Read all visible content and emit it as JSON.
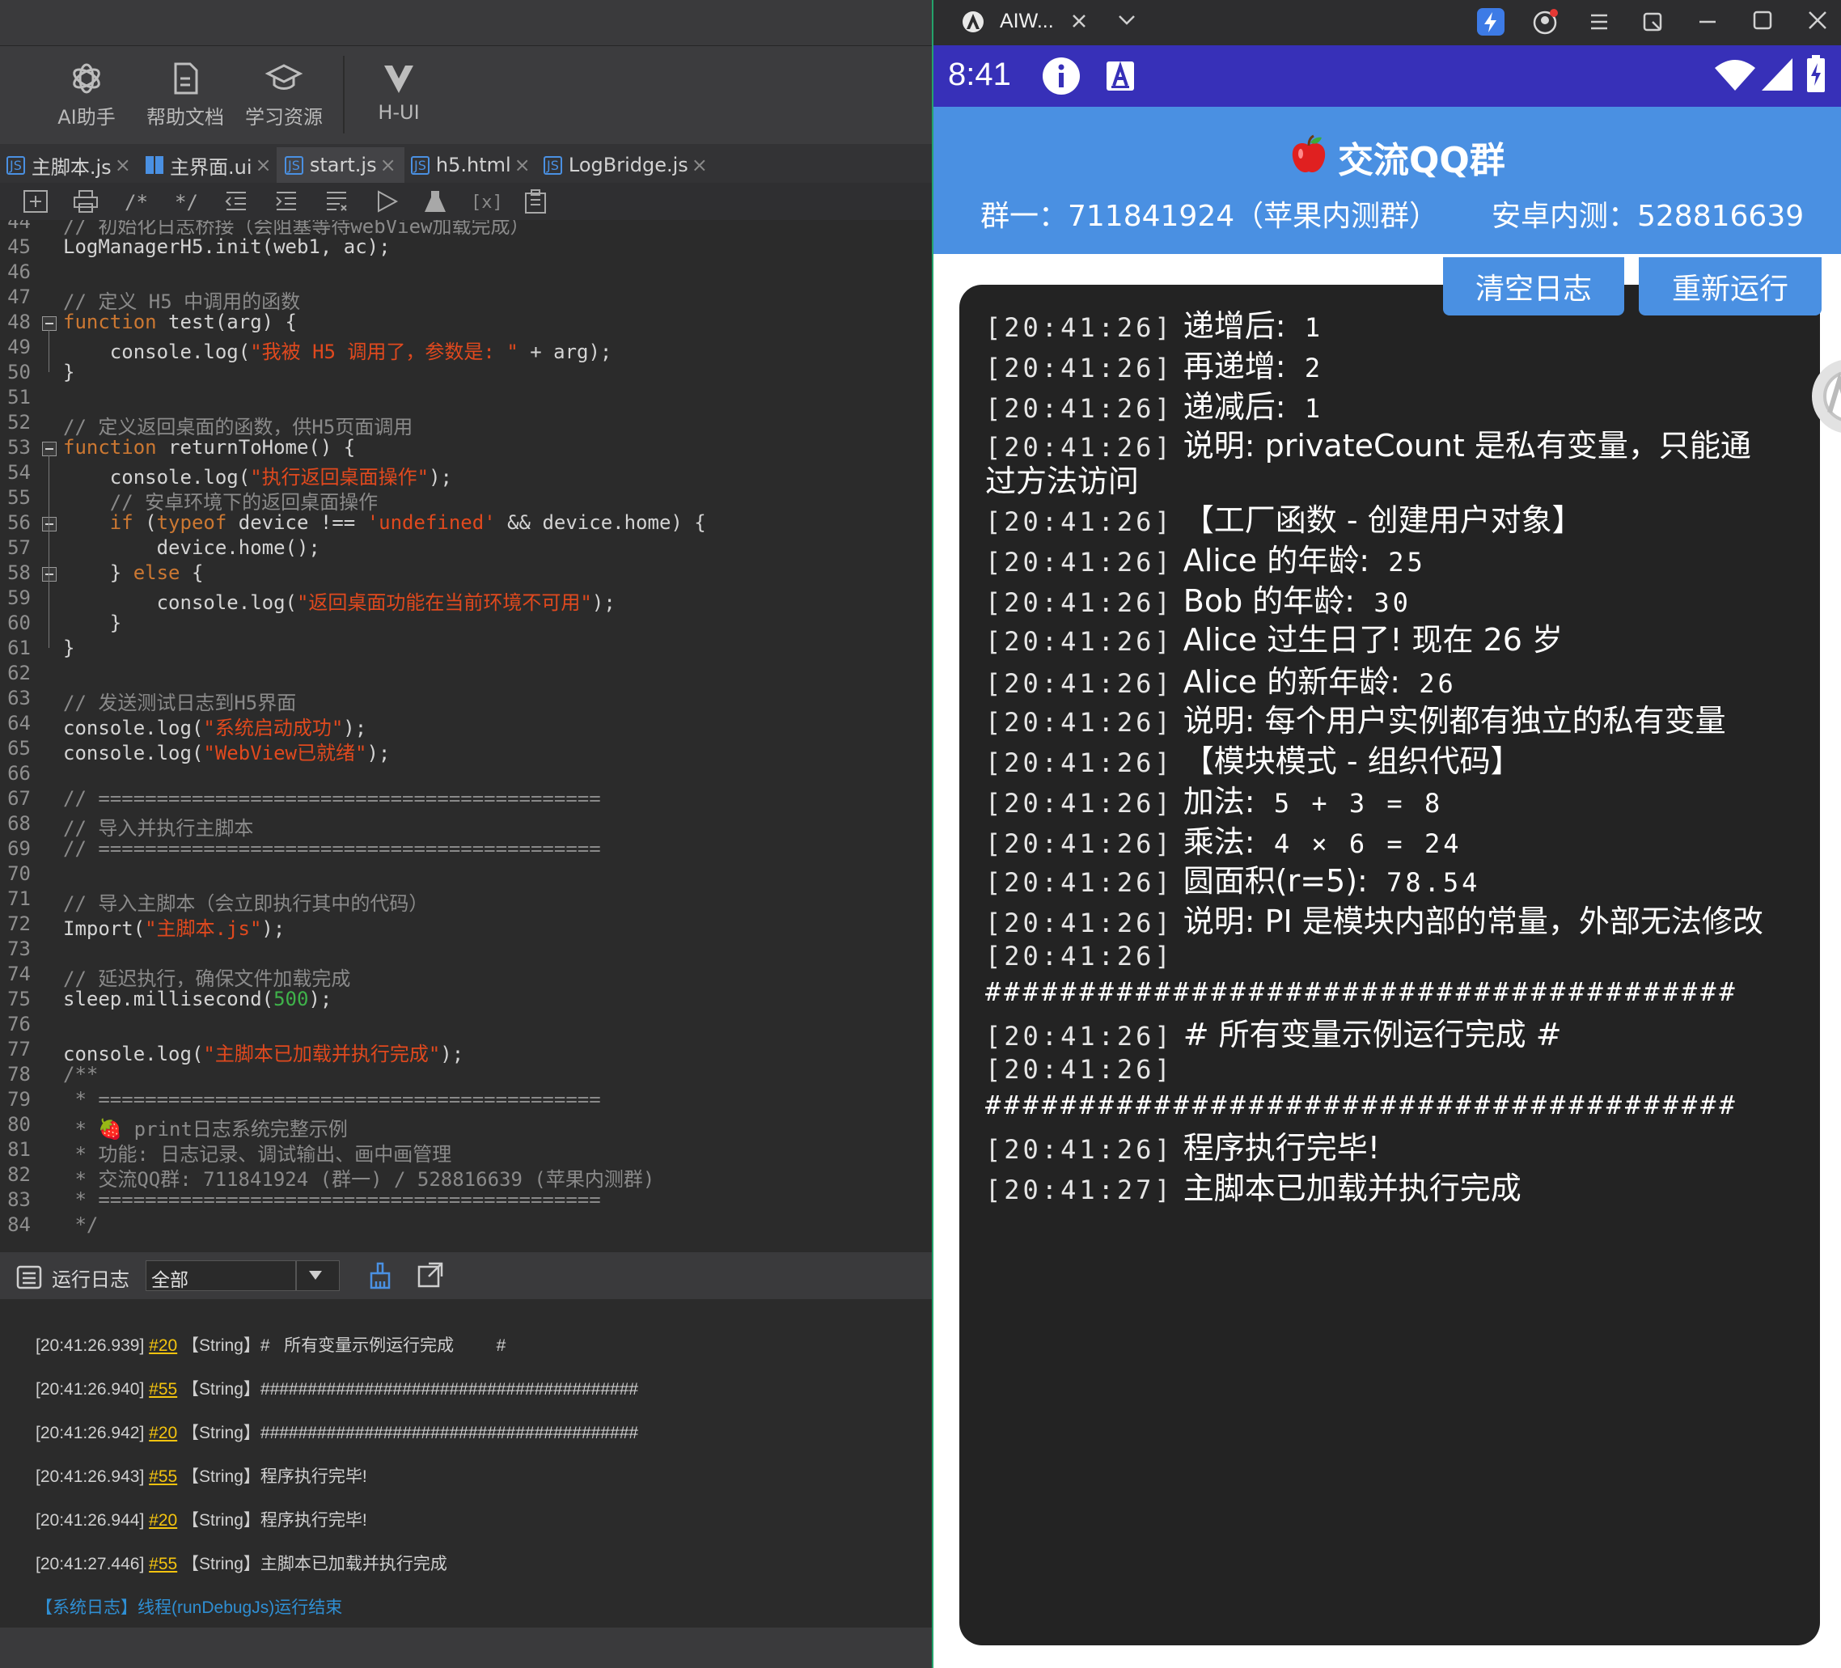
{
  "ide": {
    "toolbar": [
      {
        "icon": "openai-icon",
        "label": "AI助手"
      },
      {
        "icon": "document-icon",
        "label": "帮助文档"
      },
      {
        "icon": "graduation-cap-icon",
        "label": "学习资源"
      },
      {
        "icon": "v-logo-icon",
        "label": "H-UI"
      }
    ],
    "tabs": [
      {
        "label": "主脚本.js",
        "icon": "js-file-icon"
      },
      {
        "label": "主界面.ui",
        "icon": "ui-file-icon"
      },
      {
        "label": "start.js",
        "icon": "js-file-icon",
        "active": true
      },
      {
        "label": "h5.html",
        "icon": "js-file-icon"
      },
      {
        "label": "LogBridge.js",
        "icon": "js-file-icon"
      }
    ],
    "close_glyph": "×",
    "code_lines": [
      {
        "n": "44",
        "html": "<span class='c-com'>// 初始化日志桥接（会阻塞等待webView加载完成）</span>"
      },
      {
        "n": "45",
        "html": "LogManagerH5.init(web1, ac);"
      },
      {
        "n": "46",
        "html": ""
      },
      {
        "n": "47",
        "html": "<span class='c-com'>// 定义 H5 中调用的函数</span>"
      },
      {
        "n": "48",
        "html": "<span class='c-kw'>function</span> test(arg) {",
        "fold": true
      },
      {
        "n": "49",
        "html": "    console.log(<span class='c-str'>\"我被 H5 调用了，参数是: \"</span> + arg);"
      },
      {
        "n": "50",
        "html": "}"
      },
      {
        "n": "51",
        "html": ""
      },
      {
        "n": "52",
        "html": "<span class='c-com'>// 定义返回桌面的函数，供H5页面调用</span>"
      },
      {
        "n": "53",
        "html": "<span class='c-kw'>function</span> returnToHome() {",
        "fold": true
      },
      {
        "n": "54",
        "html": "    console.log(<span class='c-str'>\"执行返回桌面操作\"</span>);"
      },
      {
        "n": "55",
        "html": "    <span class='c-com'>// 安卓环境下的返回桌面操作</span>"
      },
      {
        "n": "56",
        "html": "    <span class='c-kw'>if</span> (<span class='c-kw'>typeof</span> device !== <span class='c-str'>'undefined'</span> &amp;&amp; device.home) {",
        "fold": true
      },
      {
        "n": "57",
        "html": "        device.home();"
      },
      {
        "n": "58",
        "html": "    } <span class='c-kw'>else</span> {",
        "fold": true
      },
      {
        "n": "59",
        "html": "        console.log(<span class='c-str'>\"返回桌面功能在当前环境不可用\"</span>);"
      },
      {
        "n": "60",
        "html": "    }"
      },
      {
        "n": "61",
        "html": "}"
      },
      {
        "n": "62",
        "html": ""
      },
      {
        "n": "63",
        "html": "<span class='c-com'>// 发送测试日志到H5界面</span>"
      },
      {
        "n": "64",
        "html": "console.log(<span class='c-str'>\"系统启动成功\"</span>);"
      },
      {
        "n": "65",
        "html": "console.log(<span class='c-str'>\"WebView已就绪\"</span>);"
      },
      {
        "n": "66",
        "html": ""
      },
      {
        "n": "67",
        "html": "<span class='c-com'>// ===========================================</span>"
      },
      {
        "n": "68",
        "html": "<span class='c-com'>// 导入并执行主脚本</span>"
      },
      {
        "n": "69",
        "html": "<span class='c-com'>// ===========================================</span>"
      },
      {
        "n": "70",
        "html": ""
      },
      {
        "n": "71",
        "html": "<span class='c-com'>// 导入主脚本（会立即执行其中的代码）</span>"
      },
      {
        "n": "72",
        "html": "Import(<span class='c-str'>\"主脚本.js\"</span>);"
      },
      {
        "n": "73",
        "html": ""
      },
      {
        "n": "74",
        "html": "<span class='c-com'>// 延迟执行，确保文件加载完成</span>"
      },
      {
        "n": "75",
        "html": "sleep.millisecond(<span class='c-num'>500</span>);"
      },
      {
        "n": "76",
        "html": ""
      },
      {
        "n": "77",
        "html": "console.log(<span class='c-str'>\"主脚本已加载并执行完成\"</span>);"
      },
      {
        "n": "78",
        "html": "<span class='c-com'>/**</span>"
      },
      {
        "n": "79",
        "html": "<span class='c-com'> * ===========================================</span>"
      },
      {
        "n": "80",
        "html": "<span class='c-com'> * 🍓 print日志系统完整示例</span>"
      },
      {
        "n": "81",
        "html": "<span class='c-com'> * 功能: 日志记录、调试输出、画中画管理</span>"
      },
      {
        "n": "82",
        "html": "<span class='c-com'> * 交流QQ群: 711841924 (群一) / 528816639 (苹果内测群)</span>"
      },
      {
        "n": "83",
        "html": "<span class='c-com'> * ===========================================</span>"
      },
      {
        "n": "84",
        "html": "<span class='c-com'> */</span>"
      }
    ],
    "logbar": {
      "title": "运行日志",
      "filter": "全部"
    },
    "logs": [
      {
        "ts": "[20:41:26.939]",
        "ref": "#20",
        "type": "【String】",
        "msg": "#   所有变量示例运行完成         #"
      },
      {
        "ts": "[20:41:26.940]",
        "ref": "#55",
        "type": "【String】",
        "msg": "########################################"
      },
      {
        "ts": "[20:41:26.942]",
        "ref": "#20",
        "type": "【String】",
        "msg": "########################################"
      },
      {
        "ts": "[20:41:26.943]",
        "ref": "#55",
        "type": "【String】",
        "msg": "程序执行完毕!"
      },
      {
        "ts": "[20:41:26.944]",
        "ref": "#20",
        "type": "【String】",
        "msg": "程序执行完毕!"
      },
      {
        "ts": "[20:41:27.446]",
        "ref": "#55",
        "type": "【String】",
        "msg": "主脚本已加载并执行完成"
      }
    ],
    "system_log": "【系统日志】线程(runDebugJs)运行结束"
  },
  "emulator": {
    "window_tab": "AIW...",
    "time": "8:41",
    "banner": {
      "title": "交流QQ群",
      "group1": "群一：711841924（苹果内测群）",
      "group2": "安卓内测：528816639"
    },
    "buttons": {
      "clear": "清空日志",
      "rerun": "重新运行"
    },
    "log_rows": [
      {
        "ts": "[20:41:26]",
        "msg": "递增后:",
        "mono": " 1"
      },
      {
        "ts": "[20:41:26]",
        "msg": "再递增:",
        "mono": " 2"
      },
      {
        "ts": "[20:41:26]",
        "msg": "递减后:",
        "mono": " 1"
      },
      {
        "ts": "[20:41:26]",
        "msg": "说明: privateCount 是私有变量，只能通"
      },
      {
        "ts": "",
        "msg": "过方法访问"
      },
      {
        "ts": "[20:41:26]",
        "msg": "【工厂函数 - 创建用户对象】"
      },
      {
        "ts": "[20:41:26]",
        "msg": "Alice 的年龄:",
        "mono": " 25"
      },
      {
        "ts": "[20:41:26]",
        "msg": "Bob 的年龄:",
        "mono": " 30"
      },
      {
        "ts": "[20:41:26]",
        "msg": "Alice 过生日了! 现在 26 岁"
      },
      {
        "ts": "[20:41:26]",
        "msg": "Alice 的新年龄:",
        "mono": " 26"
      },
      {
        "ts": "[20:41:26]",
        "msg": "说明: 每个用户实例都有独立的私有变量"
      },
      {
        "ts": "[20:41:26]",
        "msg": "【模块模式 - 组织代码】"
      },
      {
        "ts": "[20:41:26]",
        "msg": "加法:",
        "mono": " 5 + 3 = 8"
      },
      {
        "ts": "[20:41:26]",
        "msg": "乘法:",
        "mono": " 4 × 6 = 24"
      },
      {
        "ts": "[20:41:26]",
        "msg": "圆面积(r=5):",
        "mono": " 78.54"
      },
      {
        "ts": "[20:41:26]",
        "msg": "说明: PI 是模块内部的常量，外部无法修改"
      },
      {
        "ts": "[20:41:26]",
        "msg": ""
      },
      {
        "ts": "",
        "msg": "",
        "mono": "########################################"
      },
      {
        "ts": "[20:41:26]",
        "msg": "# 所有变量示例运行完成 #"
      },
      {
        "ts": "[20:41:26]",
        "msg": ""
      },
      {
        "ts": "",
        "msg": "",
        "mono": "########################################"
      },
      {
        "ts": "[20:41:26]",
        "msg": "程序执行完毕!"
      },
      {
        "ts": "[20:41:27]",
        "msg": "主脚本已加载并执行完成"
      }
    ]
  }
}
